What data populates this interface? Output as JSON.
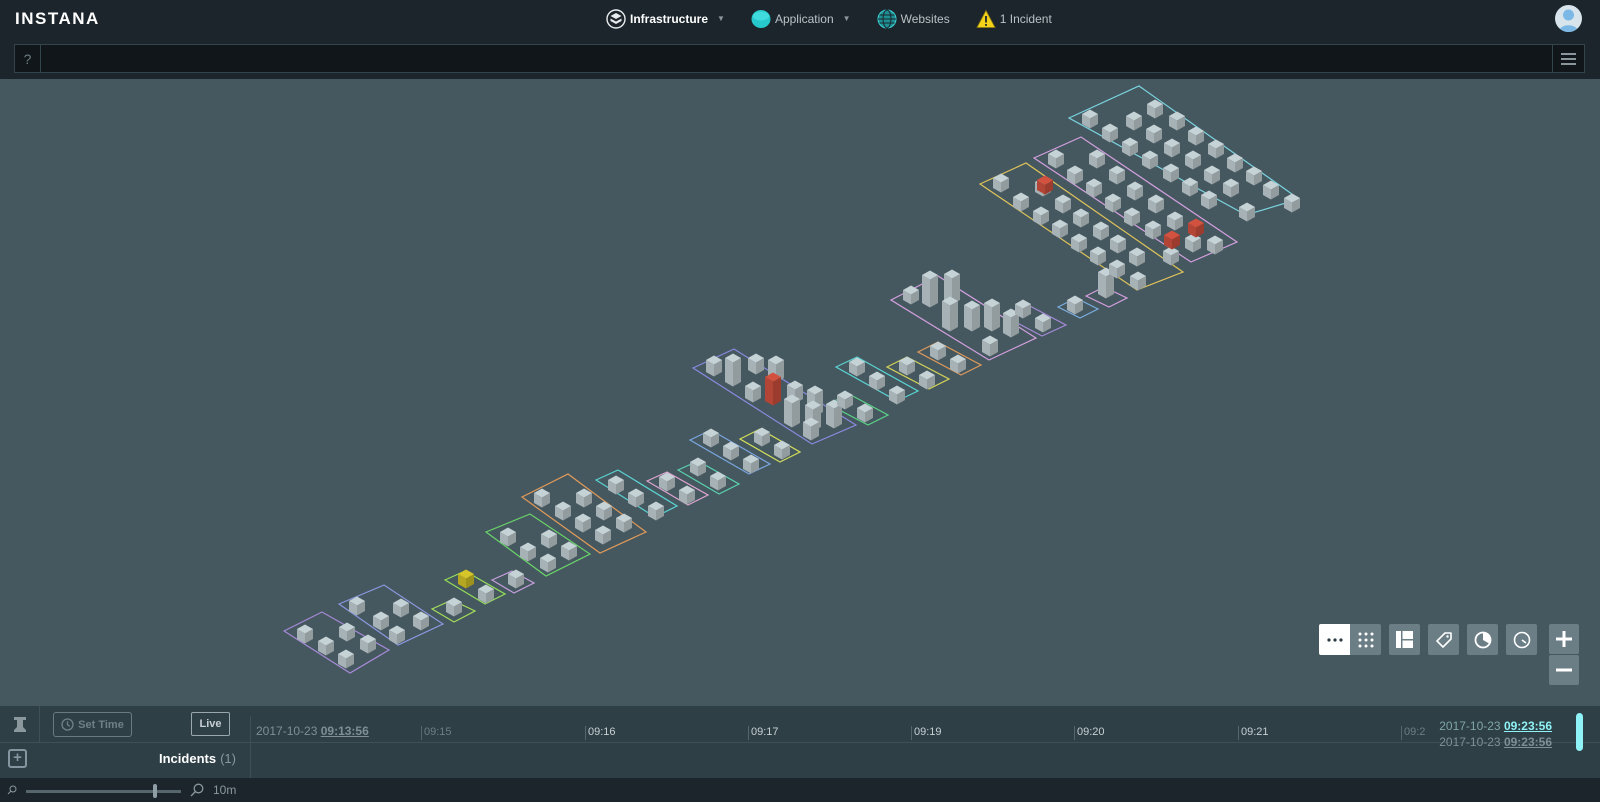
{
  "header": {
    "logo": "INSTANA",
    "nav": [
      {
        "label": "Infrastructure",
        "icon": "infrastructure-cube-icon",
        "dropdown": true,
        "active": true
      },
      {
        "label": "Application",
        "icon": "application-disc-icon",
        "dropdown": true,
        "active": false
      },
      {
        "label": "Websites",
        "icon": "globe-icon",
        "dropdown": false,
        "active": false
      },
      {
        "label": "1 Incident",
        "icon": "warning-triangle-icon",
        "dropdown": false,
        "active": false
      }
    ],
    "avatar_icon": "user-avatar-icon"
  },
  "search": {
    "help_label": "?",
    "value": "",
    "placeholder": ""
  },
  "map": {
    "view_controls": [
      {
        "name": "list-view",
        "icon": "dots-horizontal-icon",
        "selected": true
      },
      {
        "name": "grid-view",
        "icon": "dots-grid-icon",
        "selected": false
      },
      {
        "name": "layout",
        "icon": "layout-icon",
        "selected": false
      },
      {
        "name": "tags",
        "icon": "tag-icon",
        "selected": false
      },
      {
        "name": "pie",
        "icon": "pie-chart-icon",
        "selected": false
      },
      {
        "name": "gauge",
        "icon": "gauge-icon",
        "selected": false
      }
    ],
    "zoom_in_label": "+",
    "zoom_out_label": "−",
    "colors": {
      "host_default": "#b6c2c6",
      "host_critical": "#c24b3a",
      "host_warning": "#c6b626"
    }
  },
  "timeline": {
    "set_time_label": "Set Time",
    "live_label": "Live",
    "start_date": "2017-10-23",
    "start_time": "09:13:56",
    "ticks": [
      {
        "label": "09:15",
        "faint": true
      },
      {
        "label": "09:16",
        "faint": false
      },
      {
        "label": "09:17",
        "faint": false
      },
      {
        "label": "09:19",
        "faint": false
      },
      {
        "label": "09:20",
        "faint": false
      },
      {
        "label": "09:21",
        "faint": false
      },
      {
        "label": "09:2",
        "faint": true
      }
    ],
    "end_date": "2017-10-23",
    "end_time": "09:23:56",
    "end_date_2": "2017-10-23",
    "end_time_2": "09:23:56",
    "incidents_label": "Incidents",
    "incidents_count": "(1)",
    "zoom_value": "10m",
    "zoom_fraction": 0.83
  }
}
